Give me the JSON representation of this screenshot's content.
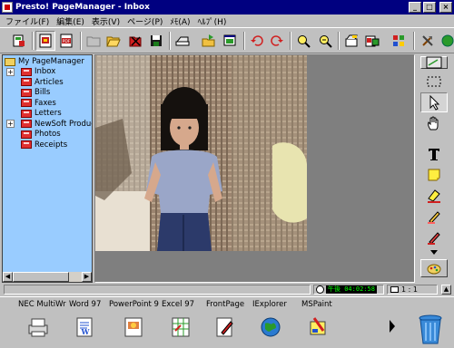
{
  "window": {
    "title": "Presto! PageManager - Inbox",
    "minimize": "_",
    "maximize": "□",
    "close": "×"
  },
  "menu": [
    "ファイル(F)",
    "編集(E)",
    "表示(V)",
    "ページ(P)",
    "ﾒﾓ(A)",
    "ﾍﾙﾌﾟ(H)"
  ],
  "tree": {
    "root": "My PageManager",
    "items": [
      {
        "label": "Inbox",
        "expander": "+"
      },
      {
        "label": "Articles"
      },
      {
        "label": "Bills"
      },
      {
        "label": "Faxes"
      },
      {
        "label": "Letters"
      },
      {
        "label": "NewSoft Products",
        "expander": "+"
      },
      {
        "label": "Photos"
      },
      {
        "label": "Receipts"
      }
    ]
  },
  "status": {
    "time": "午後 04:02:58",
    "page": "1 : 1"
  },
  "apps": [
    {
      "label": "NEC MultiWr",
      "icon": "printer-icon"
    },
    {
      "label": "Word 97",
      "icon": "word-icon"
    },
    {
      "label": "PowerPoint 9",
      "icon": "powerpoint-icon"
    },
    {
      "label": "Excel 97",
      "icon": "excel-icon"
    },
    {
      "label": "FrontPage",
      "icon": "frontpage-icon"
    },
    {
      "label": "IExplorer",
      "icon": "globe-icon"
    },
    {
      "label": "MSPaint",
      "icon": "paint-icon"
    }
  ],
  "colors": {
    "titlebar": "#000080",
    "tree_bg": "#99ccff",
    "view_bg": "#7f7f7f",
    "folder": "#e03030"
  }
}
